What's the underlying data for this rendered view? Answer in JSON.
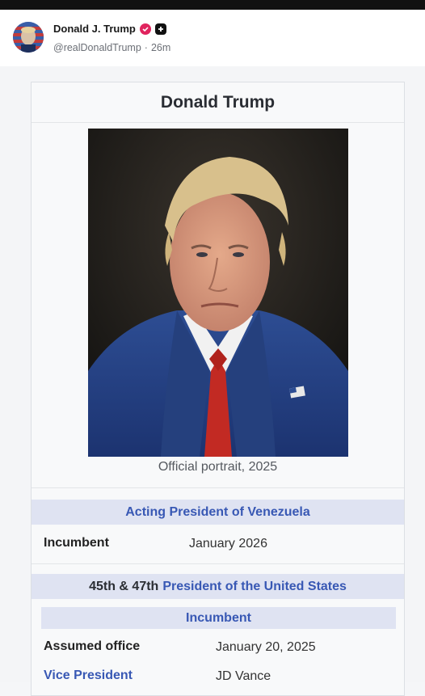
{
  "post": {
    "display_name": "Donald J. Trump",
    "handle": "@realDonaldTrump",
    "separator": "·",
    "time": "26m"
  },
  "infobox": {
    "title": "Donald Trump",
    "caption": "Official portrait, 2025",
    "section1": {
      "title": "Acting President of Venezuela",
      "row_label": "Incumbent",
      "row_value": "January 2026"
    },
    "section2": {
      "prefix": "45th & 47th",
      "title_link": "President of the United States",
      "subheader": "Incumbent",
      "rows": [
        {
          "label": "Assumed office",
          "value": "January 20, 2025"
        },
        {
          "label": "Vice President",
          "value": "JD Vance"
        }
      ]
    }
  },
  "colors": {
    "link": "#3858b4",
    "band": "#dfe3f2",
    "verified": "#e0245e"
  }
}
